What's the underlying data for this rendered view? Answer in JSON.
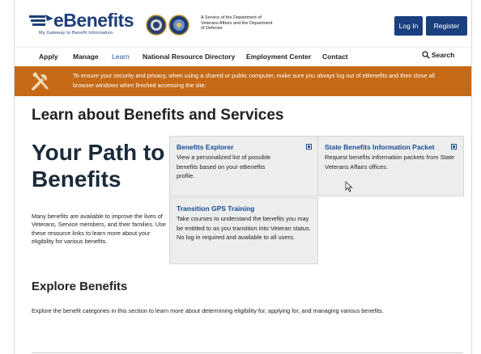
{
  "header": {
    "logo_text": "eBenefits",
    "logo_tagline": "My Gateway to Benefit Information",
    "service_text": "A Service of the Department of Veterans Affairs and the Department of Defense",
    "login_label": "Log In",
    "register_label": "Register"
  },
  "nav": {
    "items": [
      {
        "label": "Apply"
      },
      {
        "label": "Manage"
      },
      {
        "label": "Learn"
      },
      {
        "label": "National Resource Directory"
      },
      {
        "label": "Employment Center"
      },
      {
        "label": "Contact"
      }
    ],
    "active": "Learn",
    "search_label": "Search"
  },
  "banner": {
    "text": "To ensure your security and privacy, when using a shared or public computer, make sure you always log out of eBenefits and then close all browser windows when finished accessing the site.",
    "color": "#c66a17"
  },
  "main": {
    "page_title": "Learn about Benefits and Services",
    "hero_title": "Your Path to Benefits",
    "hero_desc": "Many benefits are available to improve the lives of Veterans, Service members, and their families. Use these resource links to learn more about your eligibility for various benefits.",
    "cards": [
      {
        "title": "Benefits Explorer",
        "body": "View a personalized list of possible benefits based on your eBenefits profile."
      },
      {
        "title": "State Benefits Information Packet",
        "body": "Request benefits information packets from State Veterans Affairs offices."
      },
      {
        "title": "Transition GPS Training",
        "body": "Take courses to understand the benefits you may be entitled to as you transition into Veteran status. No log in required and available to all users."
      }
    ],
    "section_title": "Explore Benefits",
    "section_desc": "Explore the benefit categories in this section to learn more about determining eligibility for, applying for, and managing various benefits."
  },
  "colors": {
    "brand_blue": "#1a3f7e",
    "link_blue": "#1a4c94",
    "banner_orange": "#c66a17",
    "card_bg": "#eceded"
  }
}
